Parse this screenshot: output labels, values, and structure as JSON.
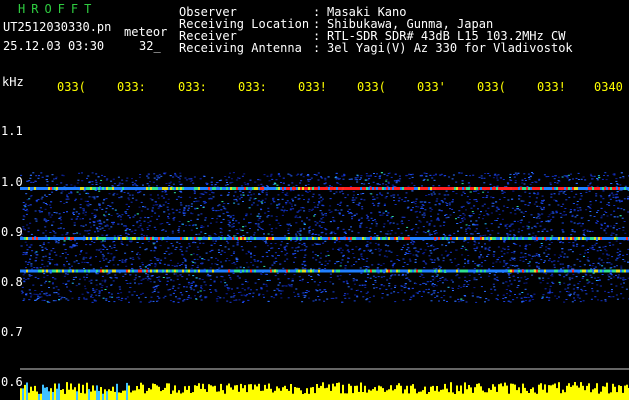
{
  "header": {
    "logo": "HROFFT",
    "filename": "UT2512030330.pn",
    "tag": "meteor",
    "datetime": "25.12.03 03:30",
    "count": "32_"
  },
  "info": {
    "observer_label": "Observer",
    "observer_value": "Masaki Kano",
    "location_label": "Receiving Location",
    "location_value": "Shibukawa, Gunma, Japan",
    "receiver_label": "Receiver",
    "receiver_value": "RTL-SDR SDR# 43dB L15 103.2MHz CW",
    "antenna_label": "Receiving Antenna",
    "antenna_value": "3el Yagi(V) Az 330 for Vladivostok",
    "separator": ":"
  },
  "axes": {
    "y_unit": "kHz",
    "x_ticks": [
      "033(",
      "033:",
      "033:",
      "033:",
      "033!",
      "033(",
      "033'",
      "033(",
      "033!",
      "0340"
    ],
    "y_ticks": [
      "1.1",
      "1.0",
      "0.9",
      "0.8",
      "0.7",
      "0.6"
    ]
  },
  "colors": {
    "background": "#000000",
    "axis_text": "#ffff00",
    "label_text": "#ffffff",
    "logo": "#2ecc40",
    "echo_band": "#1a3cff",
    "hot_echo": "#ff2020",
    "signal_strip": "#ffff00"
  },
  "spectrogram": {
    "freq_range_khz": [
      0.6,
      1.15
    ],
    "bands_khz": [
      0.99,
      0.89,
      0.825
    ],
    "time_minutes": [
      "03:30",
      "03:40"
    ]
  }
}
